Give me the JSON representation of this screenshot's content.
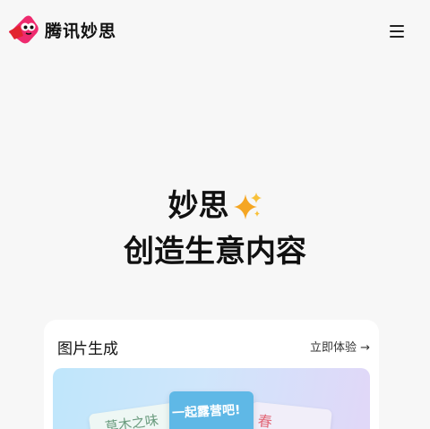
{
  "header": {
    "brand_name": "腾讯妙思",
    "logo_icon": "tencent-miaosi-logo",
    "menu_icon": "hamburger-menu-icon"
  },
  "hero": {
    "line1": "妙思",
    "sparkle_icon": "sparkles-icon",
    "line2": "创造生意内容"
  },
  "card": {
    "title": "图片生成",
    "link_label": "立即体验 →",
    "preview": {
      "note_left": "草木之味",
      "note_center": "一起露营吧!",
      "note_right": "春"
    }
  },
  "colors": {
    "background": "#f7f7f7",
    "logo_pink": "#ee2a6e",
    "logo_red": "#e2242f",
    "sparkle_orange": "#f5a623",
    "center_note": "#5fb8e6"
  }
}
